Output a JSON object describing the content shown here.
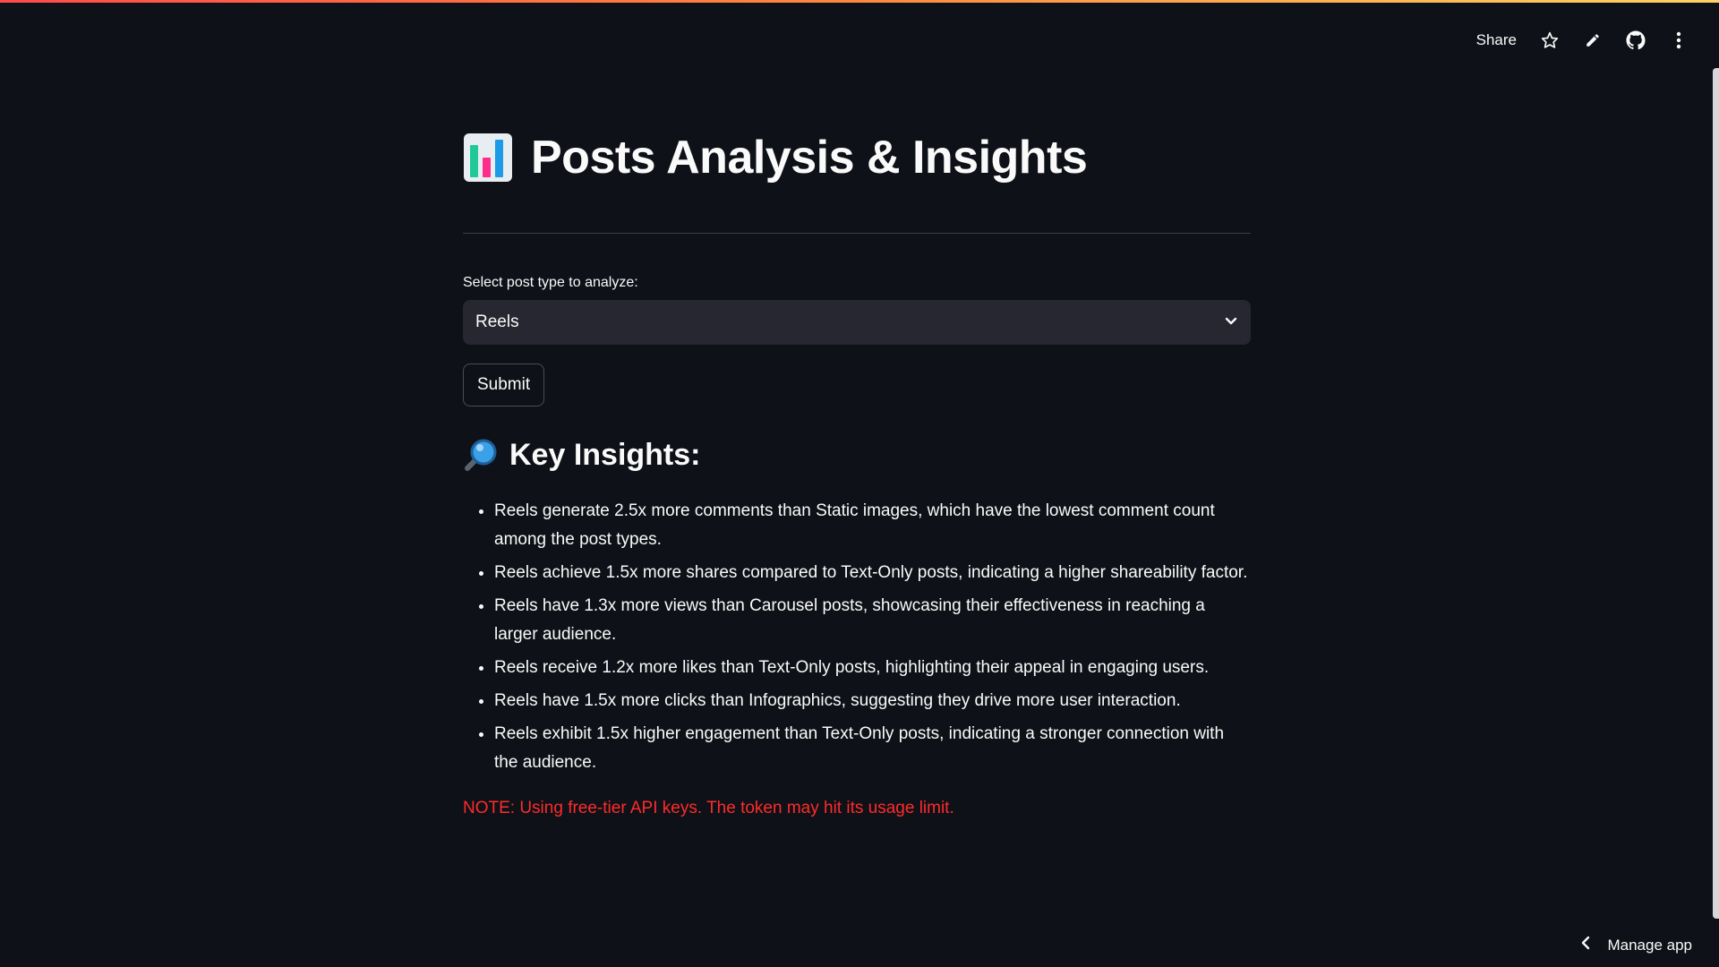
{
  "header": {
    "share_label": "Share",
    "icons": [
      "star-icon",
      "pencil-icon",
      "github-icon",
      "more-vertical-icon"
    ]
  },
  "page": {
    "title": "Posts Analysis & Insights",
    "title_icon": "bar-chart-icon"
  },
  "form": {
    "select_label": "Select post type to analyze:",
    "select_value": "Reels",
    "submit_label": "Submit"
  },
  "insights": {
    "heading": "Key Insights:",
    "heading_icon": "magnifying-glass-icon",
    "items": [
      "Reels generate 2.5x more comments than Static images, which have the lowest comment count among the post types.",
      "Reels achieve 1.5x more shares compared to Text-Only posts, indicating a higher shareability factor.",
      "Reels have 1.3x more views than Carousel posts, showcasing their effectiveness in reaching a larger audience.",
      "Reels receive 1.2x more likes than Text-Only posts, highlighting their appeal in engaging users.",
      "Reels have 1.5x more clicks than Infographics, suggesting they drive more user interaction.",
      "Reels exhibit 1.5x higher engagement than Text-Only posts, indicating a stronger connection with the audience."
    ]
  },
  "note": "NOTE: Using free-tier API keys. The token may hit its usage limit.",
  "footer": {
    "manage_app_label": "Manage app"
  },
  "colors": {
    "background": "#0e1117",
    "select_background": "#262730",
    "note_red": "#ff2b2b",
    "text": "#fafafa"
  }
}
